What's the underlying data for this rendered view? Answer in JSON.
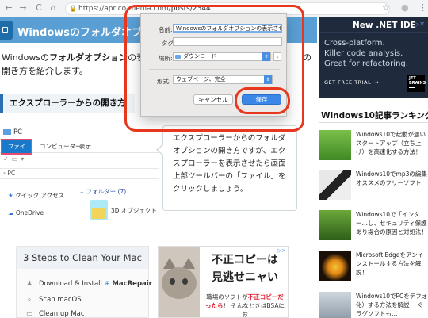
{
  "browser": {
    "url_domain": "https://aprico-media.com",
    "url_path": "/posts/2344",
    "back_glyph": "←",
    "forward_glyph": "→",
    "reload_glyph": "C",
    "home_glyph": "⌂",
    "lock_glyph": "🔒",
    "star_glyph": "☆",
    "profile_glyph": "●",
    "menu_glyph": "⋮"
  },
  "article": {
    "title": "Windowsのフォルダオプショ",
    "intro_line1_pre": "Windowsの",
    "intro_line1_bold": "フォルダオプション",
    "intro_line1_post": "の表示",
    "intro_line1_tail": "の",
    "intro_line2": "開き方を紹介します。",
    "section_heading": "エクスプローラーからの開き方"
  },
  "explorer": {
    "window_title": "PC",
    "tab_file": "ファイル",
    "tab_computer": "コンピューター",
    "tab_view": "表示",
    "path": "PC",
    "path_arrow": "›",
    "nav_quick": "クイック アクセス",
    "nav_onedrive": "OneDrive",
    "folders_heading": "フォルダー (7)",
    "folder_3d": "3D オブジェクト"
  },
  "bubble": {
    "text": "エクスプローラーからのフォルダオプションの開き方ですが、エクスプローラーを表示させたら画面上部ツールバーの「ファイル」をクリックしましょう。"
  },
  "dialog": {
    "name_label": "名前:",
    "name_value": "Windowsのフォルダオプションの表示させ方",
    "tags_label": "タグ:",
    "tags_value": "",
    "location_label": "場所:",
    "location_value": "ダウンロード",
    "format_label": "形式:",
    "format_value": "ウェブページ、完全",
    "cancel_label": "キャンセル",
    "save_label": "保存"
  },
  "ad_mac": {
    "headline": "3 Steps to Clean Your Mac",
    "row1": "Download & Install",
    "row1_brand": "MacRepair",
    "row2": "Scan macOS",
    "row3": "Clean up Mac"
  },
  "ad_jp": {
    "line1": "不正コピーは",
    "line2": "見逃せニャい",
    "sub1_pre": "職場のソフトが",
    "sub1_red": "不正コピーだ",
    "sub2_red": "ったら",
    "sub2_post": "！ そんなときはBSAにお",
    "close": "▷×"
  },
  "sidebar": {
    "net_ad_title": "New .NET IDE",
    "net_ad_line1": "Cross-platform.",
    "net_ad_line2": "Killer code analysis.",
    "net_ad_line3": "Great for refactoring.",
    "net_ad_cta": "GET FREE TRIAL",
    "net_ad_brand": "JET BRAINS",
    "ranking_title": "Windows10記事ランキング",
    "items": [
      {
        "text": "Windows10で起動が遅いスタートアップ（立ち上げ）を高速化する方法！"
      },
      {
        "text": "Windows10でmp3の編集オススメのフリーソフト"
      },
      {
        "text": "Windows10で「インター…し、セキュリティ保護あり場合の原因と対処法！"
      },
      {
        "text": "Microsoft Edgeをアンインストールする方法を解説！"
      },
      {
        "text": "Windows10でPCをデフォ化）する方法を解説！ ぐラグソフトも…"
      }
    ]
  }
}
